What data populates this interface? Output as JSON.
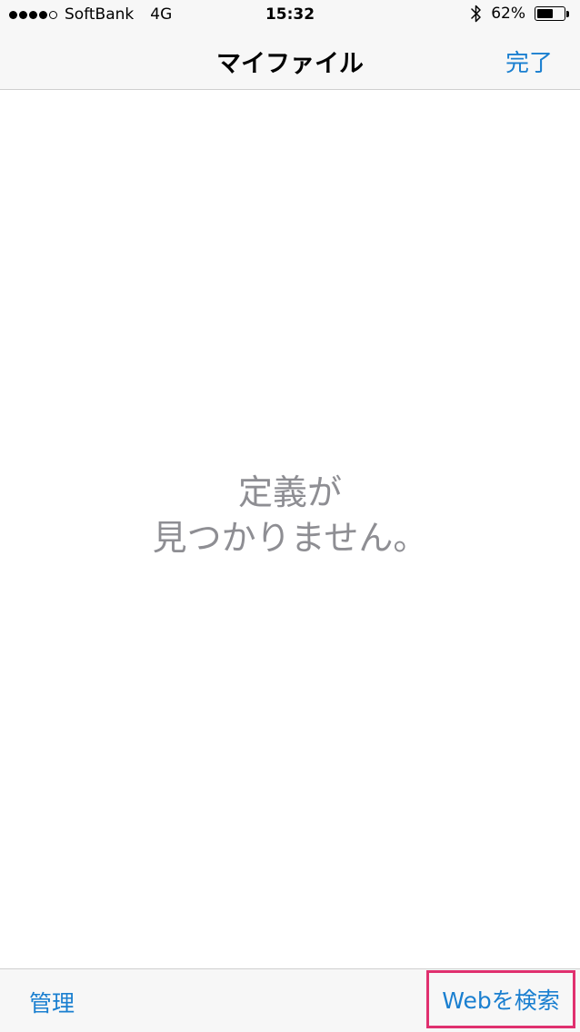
{
  "status_bar": {
    "carrier": "SoftBank",
    "network": "4G",
    "time": "15:32",
    "battery_percent": "62%",
    "battery_level": 0.62,
    "signal_bars_filled": 4,
    "signal_bars_total": 5,
    "bluetooth_icon": "bluetooth-icon"
  },
  "nav": {
    "title": "マイファイル",
    "done_label": "完了"
  },
  "content": {
    "empty_line1": "定義が",
    "empty_line2": "見つかりません。"
  },
  "toolbar": {
    "manage_label": "管理",
    "web_search_label": "Webを検索"
  },
  "colors": {
    "accent": "#1a7fd0",
    "highlight": "#e0306f",
    "empty_text": "#8e8e93",
    "bar_background": "#f7f7f7"
  }
}
